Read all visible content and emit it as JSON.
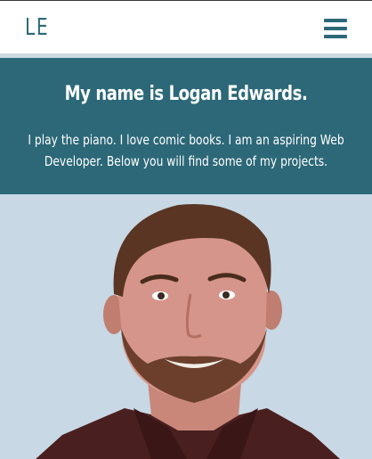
{
  "navbar": {
    "logo": "LE",
    "menu_icon": "hamburger-menu-icon"
  },
  "intro": {
    "title": "My name is Logan Edwards.",
    "text": "I play the piano. I love comic books. I am an aspiring Web Developer. Below you will find some of my projects."
  },
  "colors": {
    "brand": "#2c6878",
    "photo_background": "#c8d8e5",
    "navbar_background": "#ffffff"
  }
}
